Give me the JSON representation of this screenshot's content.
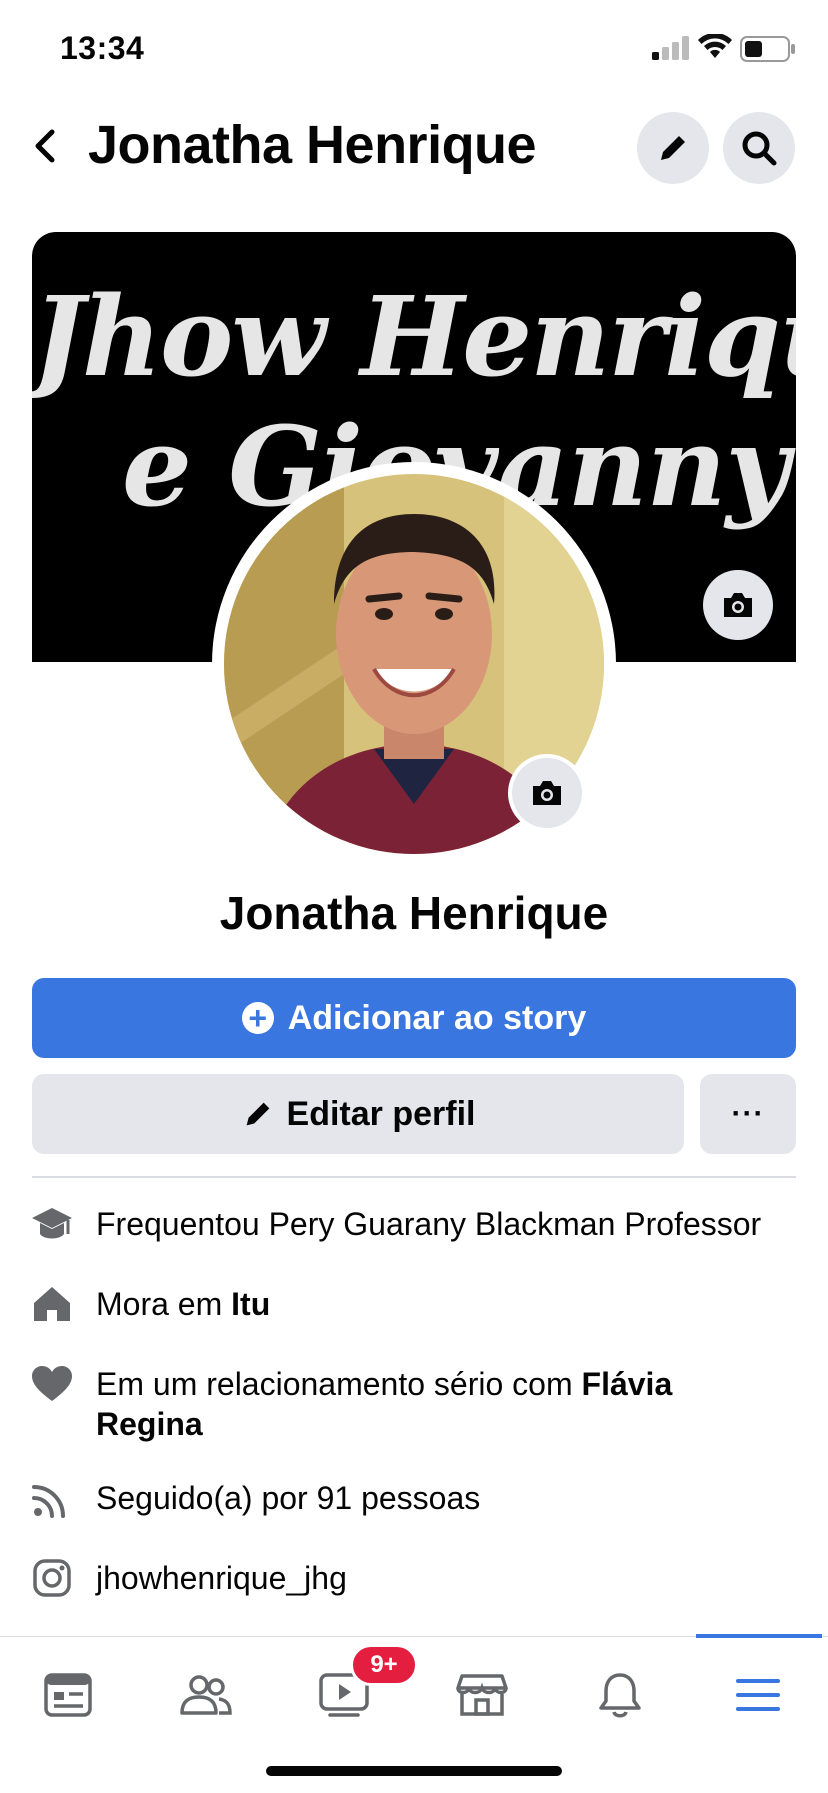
{
  "status_bar": {
    "time": "13:34"
  },
  "header": {
    "title": "Jonatha Henrique"
  },
  "cover": {
    "line1": "Jhow Henrique",
    "line2": "e Giovanny"
  },
  "profile": {
    "name": "Jonatha Henrique"
  },
  "actions": {
    "add_story": "Adicionar ao story",
    "edit_profile": "Editar perfil",
    "more": "···"
  },
  "info": [
    {
      "icon": "graduation-cap-icon",
      "text": "Frequentou Pery Guarany Blackman Professor",
      "bold": ""
    },
    {
      "icon": "home-icon",
      "text": "Mora em ",
      "bold": "Itu"
    },
    {
      "icon": "heart-icon",
      "text": "Em um relacionamento sério com ",
      "bold": "Flávia Regina"
    },
    {
      "icon": "rss-icon",
      "text": "Seguido(a) por 91 pessoas",
      "bold": ""
    },
    {
      "icon": "instagram-icon",
      "text": "jhowhenrique_jhg",
      "bold": ""
    }
  ],
  "nav": {
    "items": [
      "news-feed-icon",
      "friends-icon",
      "watch-icon",
      "marketplace-icon",
      "notifications-icon",
      "menu-icon"
    ],
    "watch_badge": "9+",
    "active": "menu-icon"
  },
  "colors": {
    "accent": "#3a76e0",
    "badge": "#e41e3f",
    "button_gray": "#e4e6eb",
    "icon_gray": "#65676b"
  }
}
